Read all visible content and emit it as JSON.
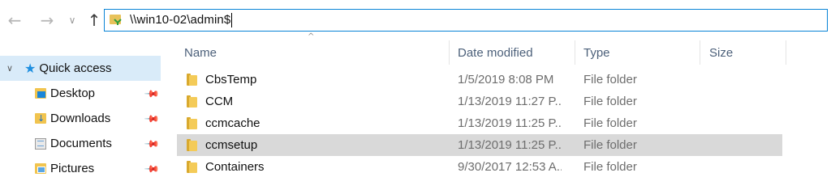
{
  "navigation": {
    "back_glyph": "←",
    "forward_glyph": "→",
    "recent_glyph": "∨",
    "up_glyph": "↑",
    "address": "\\\\win10-02\\admin$"
  },
  "nav_pane": {
    "quick_access": {
      "chevron": "∨",
      "label": "Quick access",
      "icon": "star-icon"
    },
    "items": [
      {
        "label": "Desktop",
        "icon": "desktop-icon",
        "pinned": true
      },
      {
        "label": "Downloads",
        "icon": "downloads-icon",
        "pinned": true
      },
      {
        "label": "Documents",
        "icon": "documents-icon",
        "pinned": true
      },
      {
        "label": "Pictures",
        "icon": "pictures-icon",
        "pinned": true
      }
    ],
    "pin_glyph": "📌"
  },
  "file_list": {
    "sort_indicator": "^",
    "columns": [
      {
        "label": "Name"
      },
      {
        "label": "Date modified"
      },
      {
        "label": "Type"
      },
      {
        "label": "Size"
      }
    ],
    "rows": [
      {
        "name": "CbsTemp",
        "date": "1/5/2019 8:08 PM",
        "type": "File folder",
        "selected": false
      },
      {
        "name": "CCM",
        "date": "1/13/2019 11:27 P...",
        "type": "File folder",
        "selected": false
      },
      {
        "name": "ccmcache",
        "date": "1/13/2019 11:25 P...",
        "type": "File folder",
        "selected": false
      },
      {
        "name": "ccmsetup",
        "date": "1/13/2019 11:25 P...",
        "type": "File folder",
        "selected": true
      },
      {
        "name": "Containers",
        "date": "9/30/2017 12:53 A...",
        "type": "File folder",
        "selected": false
      }
    ]
  },
  "colors": {
    "accent": "#0a84d6",
    "selection_nav": "#d9ebf9",
    "selection_row": "#d9d9d9",
    "header_text": "#4c607a",
    "secondary_text": "#6d6d6d"
  }
}
